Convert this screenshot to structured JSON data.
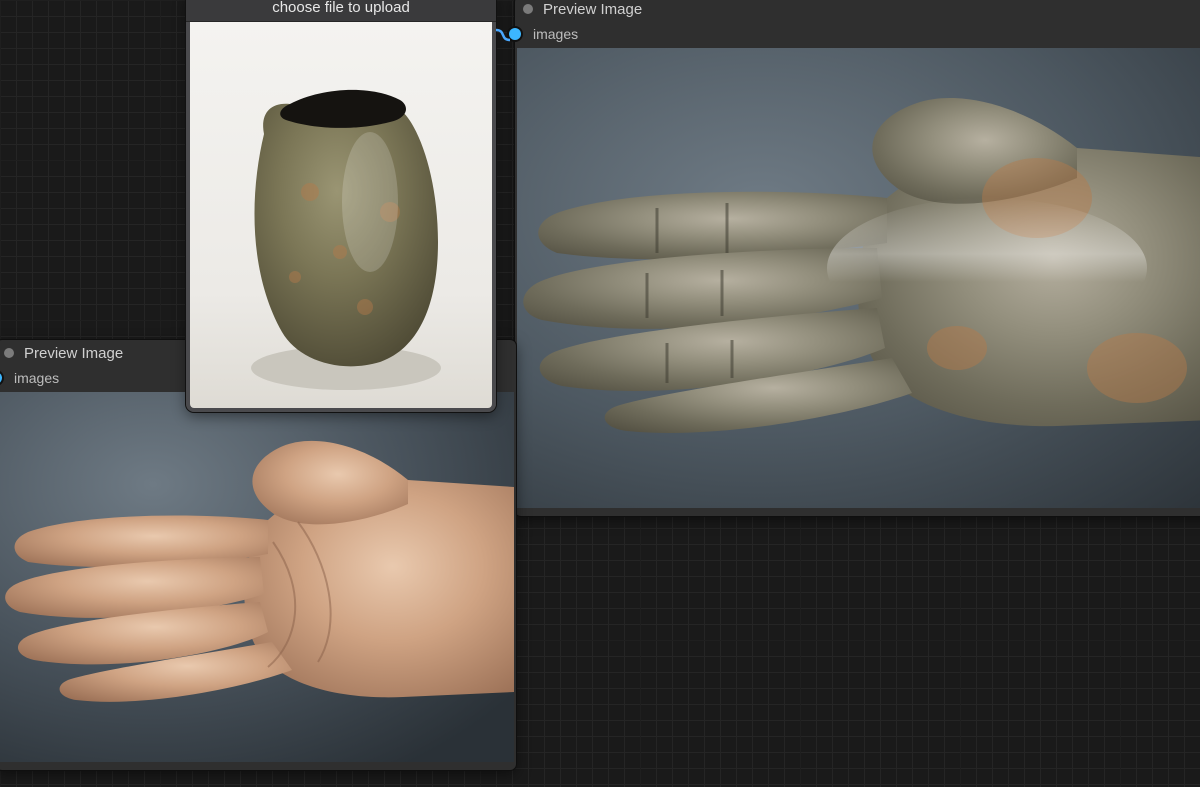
{
  "colors": {
    "port": "#3cb6ff",
    "canvas": "#1a1a1a"
  },
  "upload": {
    "button_label": "choose file to upload"
  },
  "preview_small": {
    "title": "Preview Image",
    "port_label": "images"
  },
  "preview_large": {
    "title": "Preview Image",
    "port_label": "images"
  }
}
